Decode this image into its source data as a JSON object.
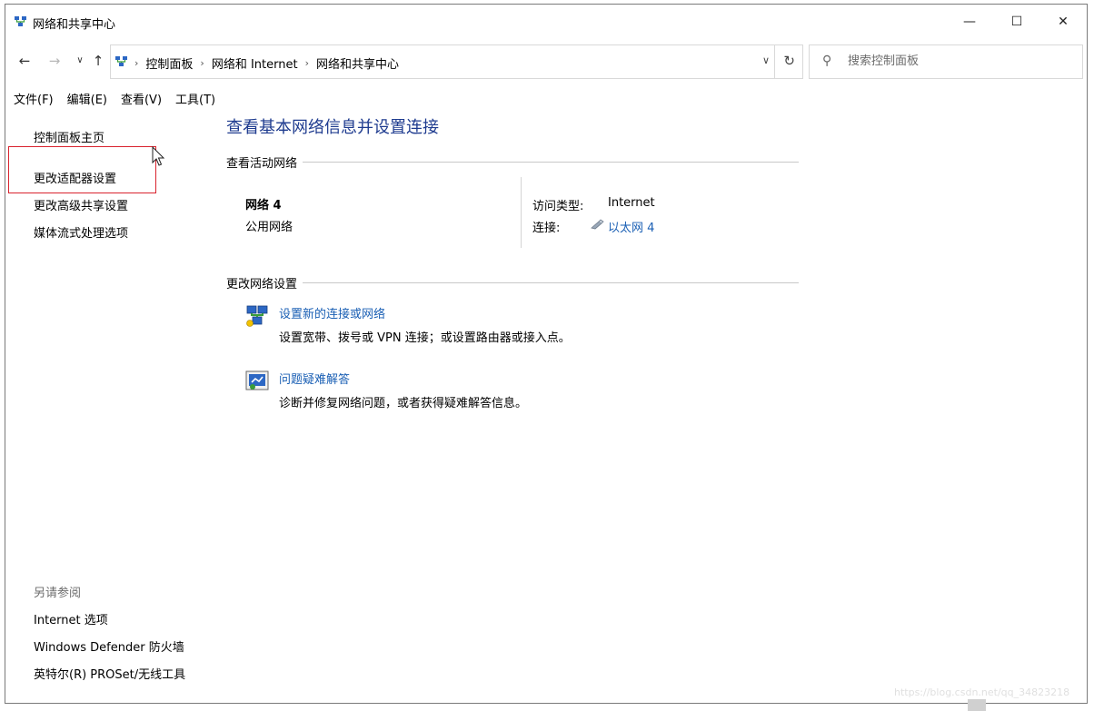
{
  "window": {
    "title": "网络和共享中心",
    "controls": {
      "minimize": "—",
      "maximize": "☐",
      "close": "✕"
    }
  },
  "nav": {
    "back_icon": "arrow-left-icon",
    "forward_icon": "arrow-right-icon",
    "recent_icon": "chevron-down-icon",
    "up_icon": "arrow-up-icon",
    "breadcrumbs": [
      "控制面板",
      "网络和 Internet",
      "网络和共享中心"
    ],
    "search": {
      "placeholder": "搜索控制面板",
      "value": ""
    }
  },
  "menu": [
    "文件(F)",
    "编辑(E)",
    "查看(V)",
    "工具(T)"
  ],
  "sidebar": {
    "links": [
      "控制面板主页",
      "更改适配器设置",
      "更改高级共享设置",
      "媒体流式处理选项"
    ],
    "see_also_title": "另请参阅",
    "see_also": [
      "Internet 选项",
      "Windows Defender 防火墙",
      "英特尔(R) PROSet/无线工具"
    ]
  },
  "main": {
    "title": "查看基本网络信息并设置连接",
    "active_networks": {
      "heading": "查看活动网络",
      "network_name": "网络 4",
      "network_type": "公用网络",
      "access_type_label": "访问类型:",
      "access_type_value": "Internet",
      "connection_label": "连接:",
      "connection_value": "以太网 4"
    },
    "change_settings": {
      "heading": "更改网络设置",
      "tasks": [
        {
          "label": "设置新的连接或网络",
          "description": "设置宽带、拨号或 VPN 连接；或设置路由器或接入点。"
        },
        {
          "label": "问题疑难解答",
          "description": "诊断并修复网络问题，或者获得疑难解答信息。"
        }
      ]
    }
  },
  "watermark": "https://blog.csdn.net/qq_34823218",
  "colors": {
    "link": "#1a5fb4",
    "title": "#1e3b8f",
    "highlight": "#d9232e"
  }
}
